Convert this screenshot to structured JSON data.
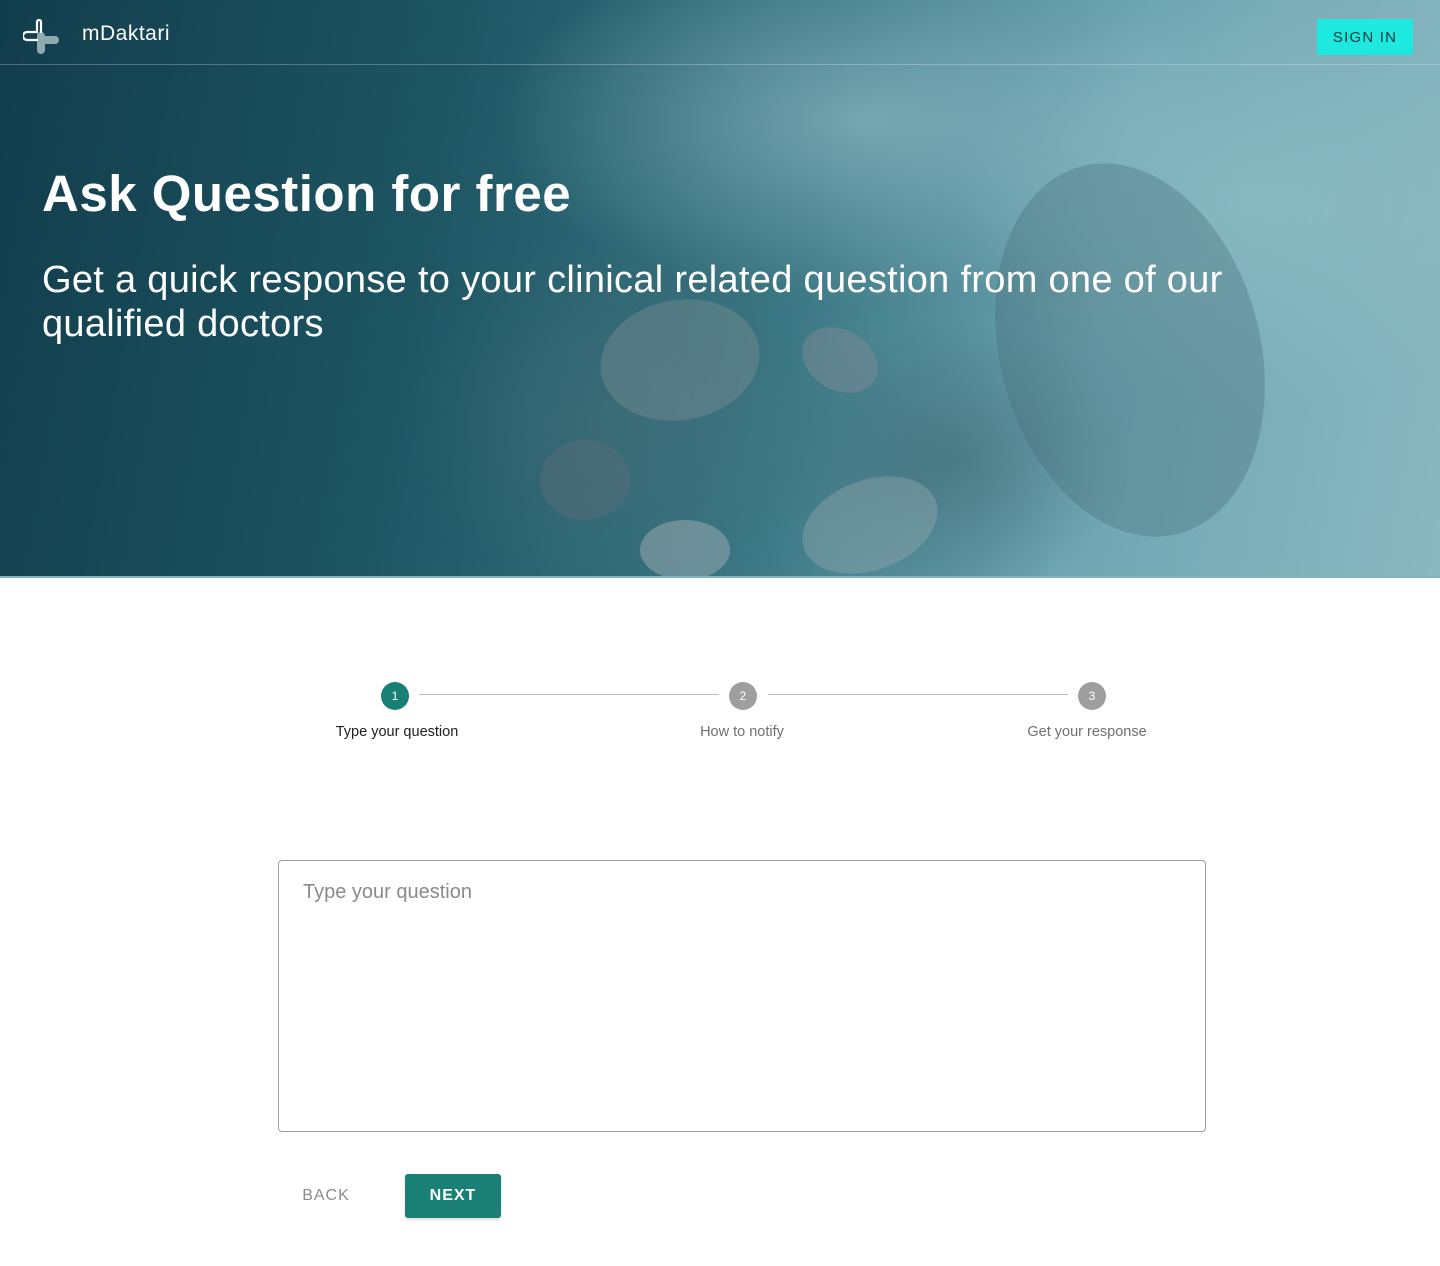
{
  "header": {
    "brand": "mDaktari",
    "logo_icon": "medical-cross-icon",
    "signin_label": "SIGN IN"
  },
  "hero": {
    "title": "Ask Question for free",
    "subtitle": "Get a quick response to your clinical related question from one of our qualified doctors"
  },
  "stepper": {
    "active_step": 1,
    "steps": [
      {
        "number": "1",
        "label": "Type your question"
      },
      {
        "number": "2",
        "label": "How to notify"
      },
      {
        "number": "3",
        "label": "Get your response"
      }
    ]
  },
  "form": {
    "question_placeholder": "Type your question",
    "question_value": ""
  },
  "actions": {
    "back_label": "BACK",
    "next_label": "NEXT"
  },
  "colors": {
    "accent": "#1a8075",
    "signin_bg": "#1de9e0",
    "inactive_step": "#9e9e9e"
  }
}
